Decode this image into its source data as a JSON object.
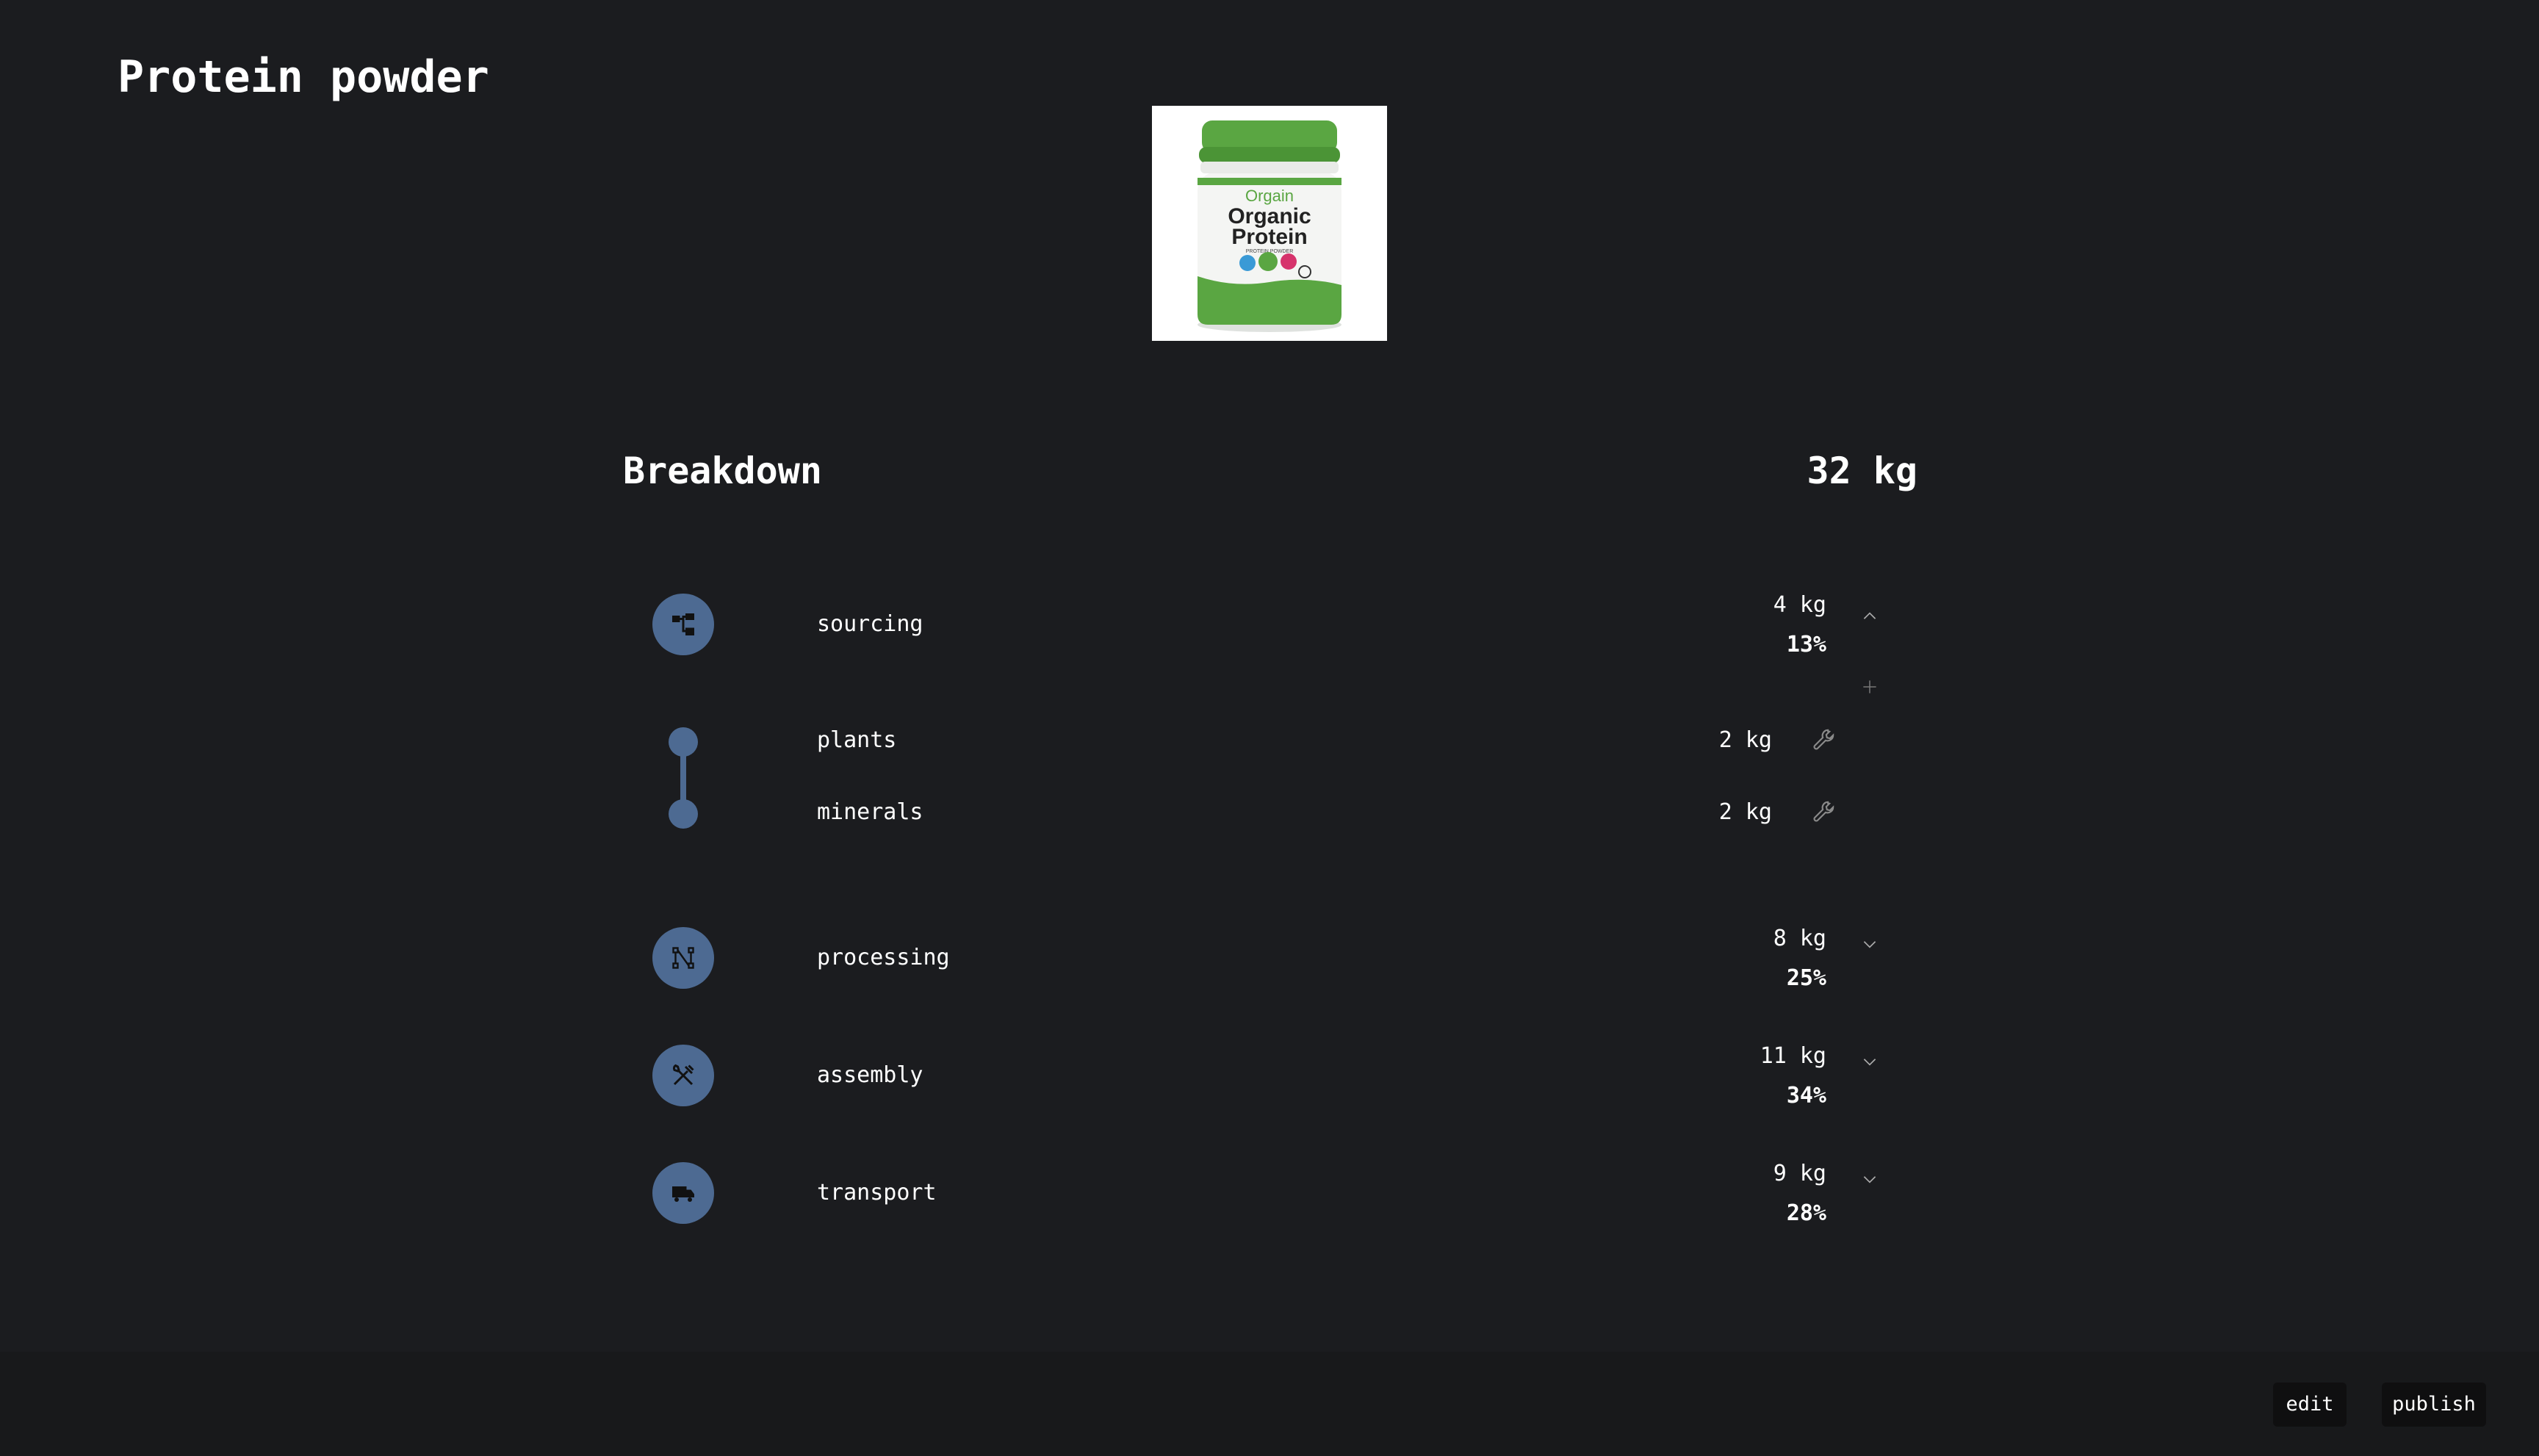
{
  "page": {
    "title": "Protein powder"
  },
  "product_image": {
    "brand": "Orgain",
    "line1": "Organic",
    "line2": "Protein",
    "subtitle": "PROTEIN POWDER",
    "accent_color": "#5aa642"
  },
  "breakdown": {
    "title": "Breakdown",
    "total": "32 kg",
    "categories": [
      {
        "label": "sourcing",
        "kg": "4 kg",
        "pct": "13%",
        "icon": "hierarchy-icon",
        "expanded": true
      },
      {
        "label": "processing",
        "kg": "8 kg",
        "pct": "25%",
        "icon": "process-nodes-icon",
        "expanded": false
      },
      {
        "label": "assembly",
        "kg": "11 kg",
        "pct": "34%",
        "icon": "tools-icon",
        "expanded": false
      },
      {
        "label": "transport",
        "kg": "9 kg",
        "pct": "28%",
        "icon": "truck-icon",
        "expanded": false
      }
    ],
    "sourcing_items": [
      {
        "label": "plants",
        "kg": "2 kg"
      },
      {
        "label": "minerals",
        "kg": "2 kg"
      }
    ]
  },
  "footer": {
    "edit_label": "edit",
    "publish_label": "publish"
  },
  "colors": {
    "background": "#1b1c1f",
    "icon_circle": "#4d6a92",
    "button_bg": "#0f0f10"
  }
}
